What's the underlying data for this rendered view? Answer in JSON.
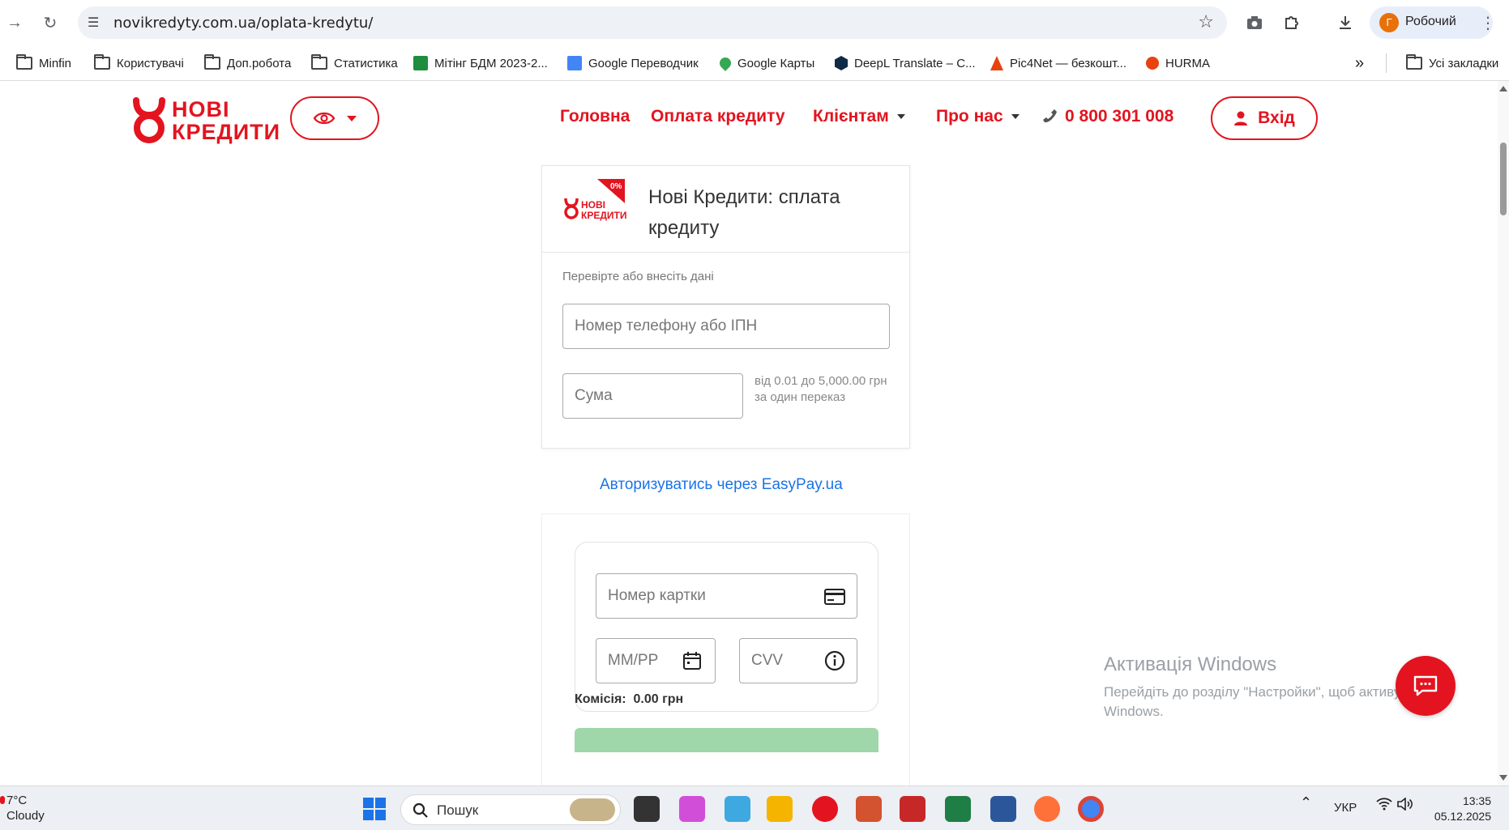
{
  "browser": {
    "url": "novikredyty.com.ua/oplata-kredytu/",
    "profile_initial": "Г",
    "profile_name": "Робочий",
    "bookmarks": [
      {
        "label": "Minfin",
        "icon": "folder-icon"
      },
      {
        "label": "Користувачі",
        "icon": "folder-icon"
      },
      {
        "label": "Доп.робота",
        "icon": "folder-icon"
      },
      {
        "label": "Статистика",
        "icon": "folder-icon"
      },
      {
        "label": "Мітінг БДМ 2023-2...",
        "icon": "sheets-icon"
      },
      {
        "label": "Google Переводчик",
        "icon": "translate-icon"
      },
      {
        "label": "Google Карты",
        "icon": "maps-icon"
      },
      {
        "label": "DeepL Translate – С...",
        "icon": "deepl-icon"
      },
      {
        "label": "Pic4Net — безкошт...",
        "icon": "pic4net-icon"
      },
      {
        "label": "HURMA",
        "icon": "hurma-icon"
      }
    ],
    "more_bookmarks": "»",
    "all_bookmarks": "Усі закладки"
  },
  "site": {
    "logo_line1": "НОВІ",
    "logo_line2": "КРЕДИТИ",
    "nav": {
      "home": "Головна",
      "payment": "Оплата кредиту",
      "clients": "Клієнтам",
      "about": "Про нас",
      "phone": "0 800 301 008"
    },
    "login": "Вхід",
    "brand_color": "#e3141f"
  },
  "payment_card": {
    "badge": "0%",
    "mini_logo_line1": "НОВІ",
    "mini_logo_line2": "КРЕДИТИ",
    "title": "Нові Кредити: сплата кредиту",
    "hint": "Перевірте або внесіть дані",
    "phone_placeholder": "Номер телефону або ІПН",
    "amount_placeholder": "Сума",
    "amount_range": "від 0.01 до 5,000.00 грн за один переказ"
  },
  "easypay_link": "Авторизуватись через EasyPay.ua",
  "card_form": {
    "card_number_placeholder": "Номер картки",
    "expiry_placeholder": "ММ/РР",
    "cvv_placeholder": "CVV",
    "commission_label": "Комісія:",
    "commission_value": "0.00 грн"
  },
  "windows_watermark": {
    "title": "Активація Windows",
    "text": "Перейдіть до розділу \"Настройки\", щоб активувати Windows."
  },
  "taskbar": {
    "temperature": "7°C",
    "weather": "Cloudy",
    "search": "Пошук",
    "lang": "УКР",
    "time": "13:35",
    "date": "05.12.2025"
  }
}
